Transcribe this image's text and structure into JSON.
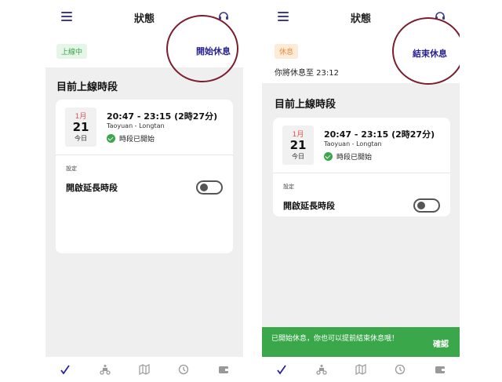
{
  "left": {
    "title": "狀態",
    "badge": "上線中",
    "action": "開始休息",
    "section_title": "目前上線時段",
    "card": {
      "month": "1月",
      "day": "21",
      "today": "今日",
      "time": "20:47 - 23:15 (2時27分)",
      "location": "Taoyuan - Longtan",
      "state": "時段已開始",
      "settings_label": "設定",
      "extend_label": "開啟延長時段"
    }
  },
  "right": {
    "title": "狀態",
    "badge": "休息",
    "action": "結束休息",
    "rest_until": "你將休息至 23:12",
    "section_title": "目前上線時段",
    "card": {
      "month": "1月",
      "day": "21",
      "today": "今日",
      "time": "20:47 - 23:15 (2時27分)",
      "location": "Taoyuan - Longtan",
      "state": "時段已開始",
      "settings_label": "設定",
      "extend_label": "開啟延長時段"
    },
    "snackbar": {
      "message": "已開始休息，你也可以提前結束休息哦！",
      "confirm": "確認"
    }
  },
  "bottom_nav": [
    "check-icon",
    "scooter-icon",
    "map-icon",
    "history-icon",
    "wallet-icon"
  ],
  "colors": {
    "accent": "#2a2290",
    "online_green": "#3aa54a",
    "rest_orange": "#e58c3b",
    "annotation_circle": "#7a1d2e"
  }
}
